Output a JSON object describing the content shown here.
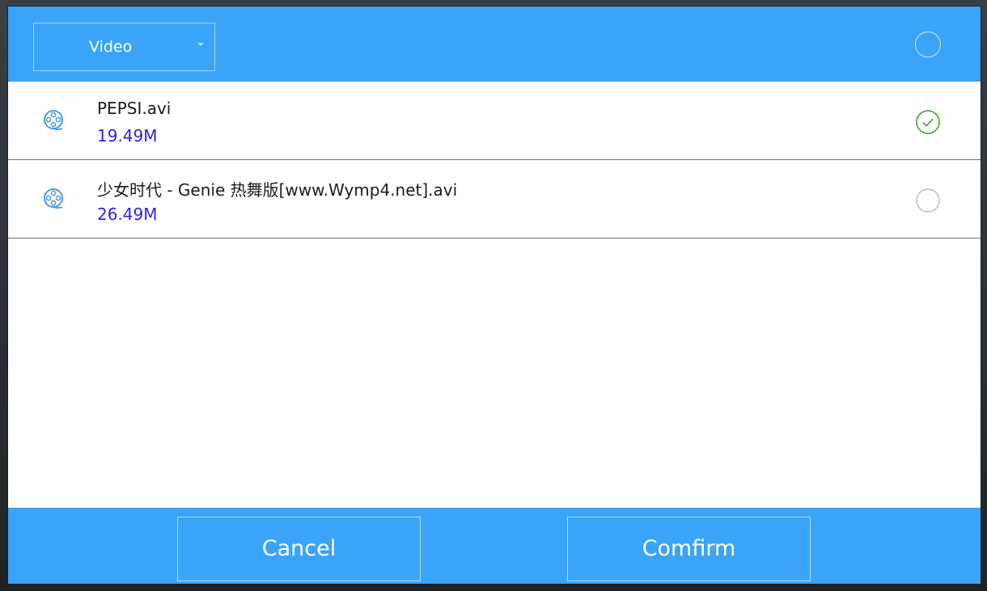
{
  "header": {
    "type_select_value": "Video"
  },
  "files": [
    {
      "name": "PEPSI.avi",
      "size": "19.49M",
      "selected": true
    },
    {
      "name": "少女时代 - Genie 热舞版[www.Wymp4.net].avi",
      "size": "26.49M",
      "selected": false
    }
  ],
  "footer": {
    "cancel_label": "Cancel",
    "confirm_label": "Comfirm"
  },
  "colors": {
    "accent": "#3aa4f8",
    "file_size_text": "#2d22e6",
    "check_green": "#4caf3c"
  },
  "icons": {
    "file": "video-reel-icon",
    "selected": "check-circle-icon",
    "unselected": "empty-circle-icon"
  }
}
